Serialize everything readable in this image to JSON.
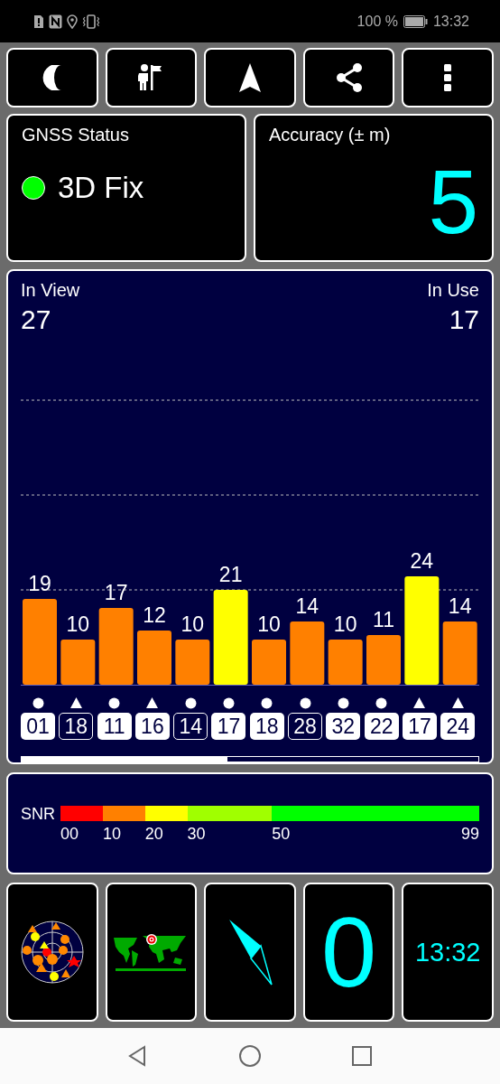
{
  "status_bar": {
    "battery": "100 %",
    "time": "13:32"
  },
  "gnss_status": {
    "title": "GNSS Status",
    "fix": "3D Fix"
  },
  "accuracy": {
    "title": "Accuracy (± m)",
    "value": "5"
  },
  "satellites": {
    "in_view_label": "In View",
    "in_view": "27",
    "in_use_label": "In Use",
    "in_use": "17",
    "chart_data": {
      "type": "bar",
      "categories": [
        "01",
        "18",
        "11",
        "16",
        "14",
        "17",
        "18",
        "28",
        "32",
        "22",
        "17",
        "24"
      ],
      "values": [
        19,
        10,
        17,
        12,
        10,
        21,
        10,
        14,
        10,
        11,
        24,
        14
      ],
      "data_labels": true
    },
    "markers": [
      {
        "kind": "circle",
        "in_use": true
      },
      {
        "kind": "triangle",
        "in_use": false
      },
      {
        "kind": "circle",
        "in_use": true
      },
      {
        "kind": "triangle",
        "in_use": true
      },
      {
        "kind": "circle",
        "in_use": false
      },
      {
        "kind": "circle",
        "in_use": true
      },
      {
        "kind": "circle",
        "in_use": true
      },
      {
        "kind": "circle",
        "in_use": false
      },
      {
        "kind": "circle",
        "in_use": true
      },
      {
        "kind": "circle",
        "in_use": true
      },
      {
        "kind": "triangle",
        "in_use": true
      },
      {
        "kind": "triangle",
        "in_use": true
      }
    ]
  },
  "snr_scale": {
    "label": "SNR",
    "segments": [
      {
        "tick": "00",
        "color": "#ff0000"
      },
      {
        "tick": "10",
        "color": "#ff8000"
      },
      {
        "tick": "20",
        "color": "#ffff00"
      },
      {
        "tick": "30",
        "color": "#a0ff00"
      },
      {
        "tick": "50",
        "color": "#00ff00"
      }
    ],
    "end_tick": "99"
  },
  "tiles": [
    {
      "kind": "skyplot"
    },
    {
      "kind": "map"
    },
    {
      "kind": "compass"
    },
    {
      "kind": "speed",
      "value": "0"
    },
    {
      "kind": "clock",
      "value": "13:32"
    }
  ]
}
